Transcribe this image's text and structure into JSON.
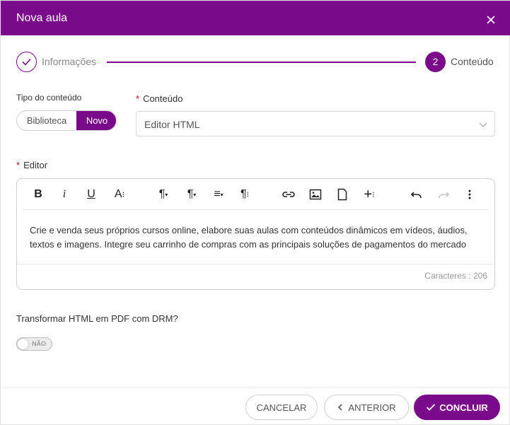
{
  "dialog": {
    "title": "Nova aula"
  },
  "stepper": {
    "step1": {
      "label": "Informações"
    },
    "step2": {
      "number": "2",
      "label": "Conteúdo"
    }
  },
  "tipo": {
    "label": "Tipo do conteúdo",
    "options": [
      "Biblioteca",
      "Novo"
    ],
    "selected": "Novo"
  },
  "conteudo": {
    "required_mark": "*",
    "label": "Conteúdo",
    "value": "Editor HTML"
  },
  "editor": {
    "required_mark": "*",
    "label": "Editor",
    "text": "Crie e venda seus próprios cursos online, elabore suas aulas com conteúdos dinâmicos em vídeos, áudios, textos e imagens. Integre seu carrinho de compras com as principais soluções de pagamentos do mercado",
    "counter": "Caracteres : 206",
    "toolbar": {
      "bold": "B",
      "italic": "i",
      "underline": "U",
      "font_size": "A",
      "paragraph_style": "¶",
      "paragraph_format": "¶",
      "align": "≡",
      "more_paragraph": "¶",
      "insert_more": "+"
    }
  },
  "drm": {
    "label": "Transformar HTML em PDF com DRM?",
    "toggle_text": "NÃO"
  },
  "buttons": {
    "cancel": "CANCELAR",
    "previous": "ANTERIOR",
    "finish": "CONCLUIR"
  },
  "colors": {
    "primary": "#7b0a8a",
    "required": "#d0021b"
  }
}
